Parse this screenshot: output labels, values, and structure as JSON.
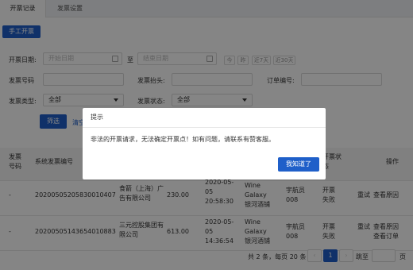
{
  "tabs": [
    "开票记录",
    "发票设置"
  ],
  "manual_button": "手工开票",
  "filters": {
    "invoice_date_label": "开票日期:",
    "start_placeholder": "开始日期",
    "range_sep": "至",
    "end_placeholder": "结束日期",
    "quick_ranges": [
      "今",
      "昨",
      "近7天",
      "近30天"
    ],
    "invoice_no_label": "发票号码",
    "invoice_title_label": "发票抬头:",
    "order_no_label": "订单编号:",
    "invoice_type_label": "发票类型:",
    "invoice_type_value": "全部",
    "invoice_status_label": "发票状态:",
    "invoice_status_value": "全部",
    "filter_button": "筛选",
    "clear_link": "清空"
  },
  "table": {
    "headers": {
      "invoice_no": "发票号码",
      "system_no": "系统发票编号",
      "status": "开票状态",
      "action": "操作"
    },
    "rows": [
      {
        "index": "-",
        "system_no": "20200505205830010407",
        "title": "食箭（上海）广告有限公司",
        "amount": "230.00",
        "time": "2020-05-05 20:58:30",
        "shop": "Wine Galaxy 银河酒铺",
        "operator": "宇航员008",
        "status": "开票失败",
        "retry": "重试",
        "detail": "查看原因"
      },
      {
        "index": "-",
        "system_no": "20200505143654010883",
        "title": "三元控股集团有限公司",
        "amount": "613.00",
        "time": "2020-05-05 14:36:54",
        "shop": "Wine Galaxy 银河酒铺",
        "operator": "宇航员008",
        "status": "开票失败",
        "retry": "重试",
        "detail": "查看原因",
        "detail2": "查看订单"
      }
    ]
  },
  "pagination": {
    "summary": "共 2 条，每页 20 条",
    "current_page": "1",
    "goto_label": "跳至",
    "page_unit": "页"
  },
  "modal": {
    "title": "提示",
    "message": "非法的开票请求，无法确定开票点！如有问题，请联系有赞客服。",
    "ok_button": "我知道了"
  }
}
